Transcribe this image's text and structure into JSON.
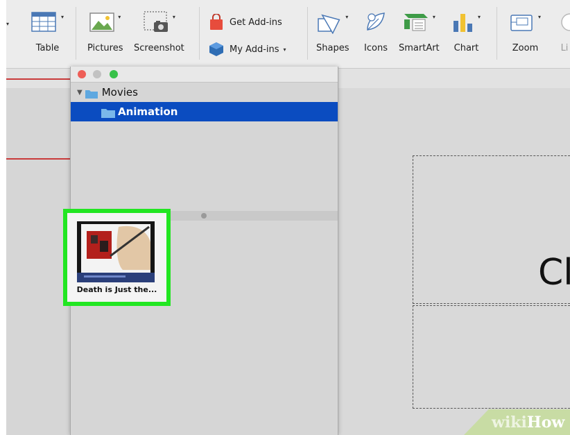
{
  "ribbon": {
    "buttons": [
      {
        "label": "Table",
        "icon": "table-icon"
      },
      {
        "label": "Pictures",
        "icon": "picture-icon"
      },
      {
        "label": "Screenshot",
        "icon": "screenshot-icon"
      },
      {
        "label": "Shapes",
        "icon": "shapes-icon"
      },
      {
        "label": "Icons",
        "icon": "icons-icon"
      },
      {
        "label": "SmartArt",
        "icon": "smartart-icon"
      },
      {
        "label": "Chart",
        "icon": "chart-icon"
      },
      {
        "label": "Zoom",
        "icon": "zoom-icon"
      },
      {
        "label": "Li",
        "icon": "link-icon"
      }
    ],
    "get_addins": "Get Add-ins",
    "my_addins": "My Add-ins"
  },
  "media_browser": {
    "tree": {
      "parent": "Movies",
      "selected_child": "Animation"
    },
    "items": [
      {
        "caption": "Death is Just the..."
      }
    ]
  },
  "slide": {
    "visible_text": "Cl"
  },
  "watermark": {
    "prefix": "wiki",
    "suffix": "How"
  },
  "colors": {
    "selection_blue": "#0b4cc0",
    "highlight_green": "#22e622",
    "close": "#ee5e57",
    "zoom": "#38c149"
  }
}
